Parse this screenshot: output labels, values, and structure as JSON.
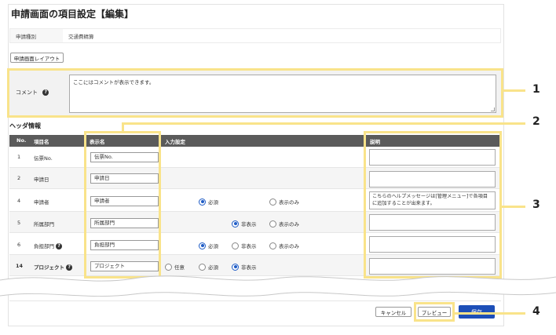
{
  "page": {
    "title": "申請画面の項目設定【編集】"
  },
  "request_type": {
    "label": "申請種別",
    "value": "交通費精算"
  },
  "layout_button": "申請画面レイアウト",
  "comment": {
    "label": "コメント",
    "help": "?",
    "text": "ここにはコメントが表示できます。"
  },
  "header_info": {
    "title": "ヘッダ情報",
    "columns": {
      "no": "No.",
      "item": "項目名",
      "display": "表示名",
      "input": "入力設定",
      "desc": "説明"
    },
    "rows": [
      {
        "no": "1",
        "item": "伝票No.",
        "display": "伝票No.",
        "help": false,
        "desc": ""
      },
      {
        "no": "2",
        "item": "申請日",
        "display": "申請日",
        "help": false,
        "desc": ""
      },
      {
        "no": "4",
        "item": "申請者",
        "display": "申請者",
        "help": false,
        "desc": "こちらのヘルプメッセージは[管理メニュー]で各項目に追加することが出来ます。"
      },
      {
        "no": "5",
        "item": "所属部門",
        "display": "所属部門",
        "help": false,
        "desc": ""
      },
      {
        "no": "6",
        "item": "負担部門",
        "display": "負担部門",
        "help": true,
        "desc": ""
      },
      {
        "no": "14",
        "item": "プロジェクト",
        "display": "プロジェクト",
        "help": true,
        "desc": ""
      }
    ],
    "radio_labels": {
      "required": "必須",
      "hidden": "非表示",
      "display_only": "表示のみ",
      "optional": "任意"
    }
  },
  "buttons": {
    "cancel": "キャンセル",
    "preview": "プレビュー",
    "save": "保存"
  },
  "callouts": [
    "1",
    "2",
    "3",
    "4"
  ],
  "colors": {
    "accent": "#1d4fb8",
    "highlight": "#f9e38a",
    "table_header": "#5b5b5b"
  }
}
